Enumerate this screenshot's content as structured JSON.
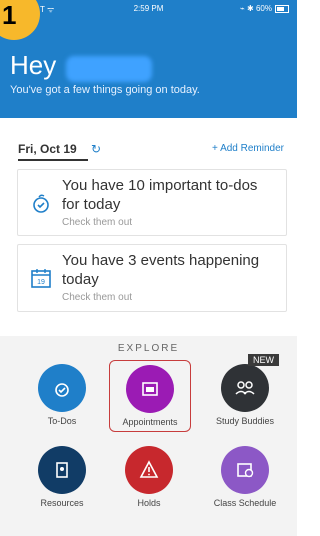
{
  "corner": {
    "number": "1"
  },
  "status": {
    "left": "T ᯤ",
    "time": "2:59 PM",
    "right": "⌁ ✱ 60%"
  },
  "header": {
    "greeting": "Hey",
    "subtitle": "You've got a few things going on today."
  },
  "date_row": {
    "date": "Fri, Oct 19",
    "add_reminder": "+ Add Reminder"
  },
  "cards": [
    {
      "title": "You have 10 important to-dos for today",
      "sub": "Check them out"
    },
    {
      "title": "You have 3 events happening today",
      "sub": "Check them out"
    }
  ],
  "explore": {
    "label": "EXPLORE",
    "tiles": [
      {
        "label": "To-Dos"
      },
      {
        "label": "Appointments"
      },
      {
        "label": "Study Buddies",
        "badge": "NEW"
      },
      {
        "label": "Resources"
      },
      {
        "label": "Holds"
      },
      {
        "label": "Class Schedule"
      }
    ]
  },
  "colors": {
    "header_blue": "#1f7fc9",
    "todos_blue": "#1f7fc9",
    "appointments_purple": "#9b1bb4",
    "study_dark": "#2f3236",
    "resources_navy": "#113c66",
    "holds_red": "#c7282d",
    "schedule_violet": "#8c58c6",
    "badge_yellow": "#f7b82b"
  }
}
